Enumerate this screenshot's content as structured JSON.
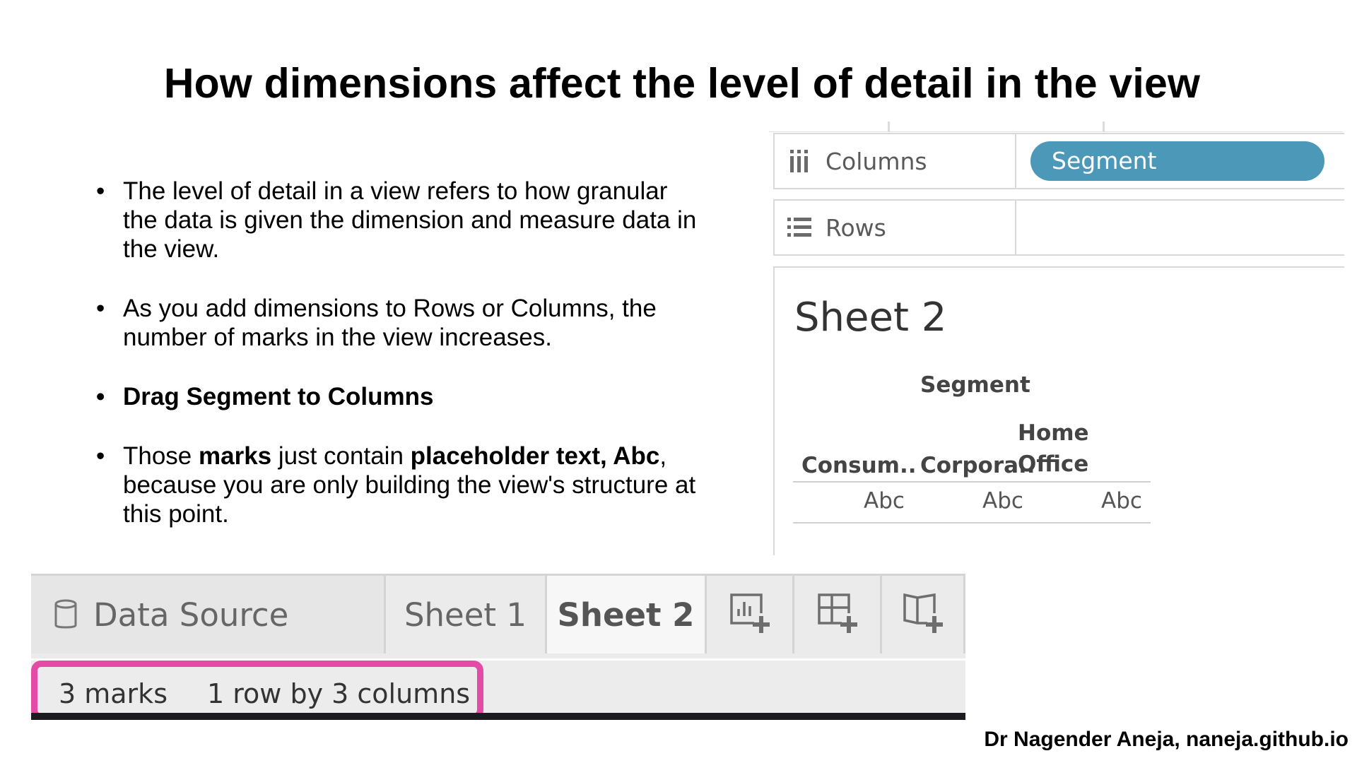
{
  "title": "How dimensions affect the level of detail in the view",
  "bullets": {
    "b1": "The level of detail in a view refers to how granular the data is given the dimension and measure data in the view.",
    "b2": "As you add dimensions to Rows or Columns, the number of marks in the view increases.",
    "b3": "Drag Segment to Columns",
    "b4": {
      "t1": "Those ",
      "t2": "marks",
      "t3": " just contain ",
      "t4": "placeholder text, Abc",
      "t5": ", because you are only building the view's structure at this point."
    }
  },
  "shelves": {
    "columns_label": "Columns",
    "columns_icon": "columns-icon",
    "columns_pill": "Segment",
    "rows_label": "Rows",
    "rows_icon": "rows-icon",
    "pill_color": "#4c98b9"
  },
  "sheet": {
    "title": "Sheet 2",
    "header": "Segment",
    "columns": [
      "Consum..",
      "Corpora..",
      "Home",
      "Office"
    ],
    "cells": [
      "Abc",
      "Abc",
      "Abc"
    ]
  },
  "tabs": {
    "data_source": "Data Source",
    "data_source_icon": "database-icon",
    "sheet1": "Sheet 1",
    "sheet2": "Sheet 2",
    "new_worksheet_icon": "new-worksheet-icon",
    "new_dashboard_icon": "new-dashboard-icon",
    "new_story_icon": "new-story-icon"
  },
  "status": {
    "marks": "3 marks",
    "dims": "1 row by 3 columns",
    "highlight_color": "#e44ba7"
  },
  "credit": "Dr Nagender Aneja, naneja.github.io"
}
